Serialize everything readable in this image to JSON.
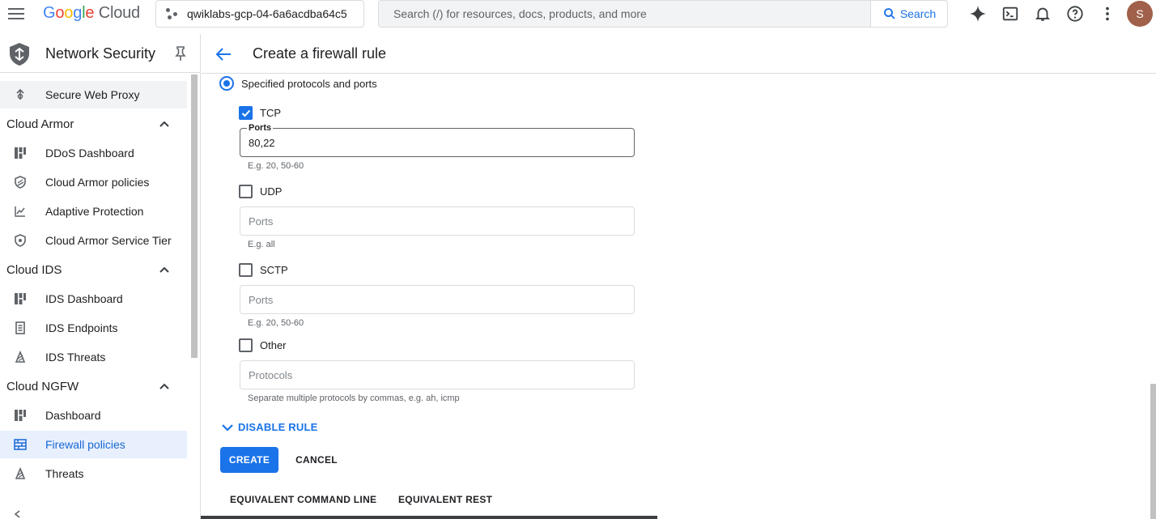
{
  "topbar": {
    "logo": {
      "g": "G",
      "o1": "o",
      "o2": "o",
      "g2": "g",
      "l": "l",
      "e": "e",
      "cloud": "Cloud"
    },
    "project": "qwiklabs-gcp-04-6a6acdba64c5",
    "search_placeholder": "Search (/) for resources, docs, products, and more",
    "search_button": "Search",
    "avatar_letter": "S"
  },
  "sidebar": {
    "title": "Network Security",
    "items_top": [
      {
        "label": "Secure Web Proxy",
        "icon": "proxy-icon"
      }
    ],
    "sections": [
      {
        "label": "Cloud Armor",
        "items": [
          {
            "label": "DDoS Dashboard",
            "icon": "dashboard-icon"
          },
          {
            "label": "Cloud Armor policies",
            "icon": "shield-icon"
          },
          {
            "label": "Adaptive Protection",
            "icon": "chart-icon"
          },
          {
            "label": "Cloud Armor Service Tier",
            "icon": "shield-small-icon"
          }
        ]
      },
      {
        "label": "Cloud IDS",
        "items": [
          {
            "label": "IDS Dashboard",
            "icon": "dashboard-icon"
          },
          {
            "label": "IDS Endpoints",
            "icon": "endpoint-icon"
          },
          {
            "label": "IDS Threats",
            "icon": "threat-icon"
          }
        ]
      },
      {
        "label": "Cloud NGFW",
        "items": [
          {
            "label": "Dashboard",
            "icon": "dashboard-icon"
          },
          {
            "label": "Firewall policies",
            "icon": "firewall-icon"
          },
          {
            "label": "Threats",
            "icon": "threat-icon"
          }
        ]
      }
    ]
  },
  "header": {
    "title": "Create a firewall rule"
  },
  "form": {
    "protocol_option": "Specified protocols and ports",
    "tcp": {
      "label": "TCP",
      "checked": true,
      "field_label": "Ports",
      "value": "80,22",
      "hint": "E.g. 20, 50-60"
    },
    "udp": {
      "label": "UDP",
      "checked": false,
      "placeholder": "Ports",
      "hint": "E.g. all"
    },
    "sctp": {
      "label": "SCTP",
      "checked": false,
      "placeholder": "Ports",
      "hint": "E.g. 20, 50-60"
    },
    "other": {
      "label": "Other",
      "checked": false,
      "placeholder": "Protocols",
      "hint": "Separate multiple protocols by commas, e.g. ah, icmp"
    },
    "disable_rule": "DISABLE RULE",
    "create": "CREATE",
    "cancel": "CANCEL",
    "equivalent_cli": "EQUIVALENT COMMAND LINE",
    "equivalent_rest": "EQUIVALENT REST"
  },
  "colors": {
    "accent": "#1a73e8",
    "active_bg": "#e8f0fe"
  }
}
